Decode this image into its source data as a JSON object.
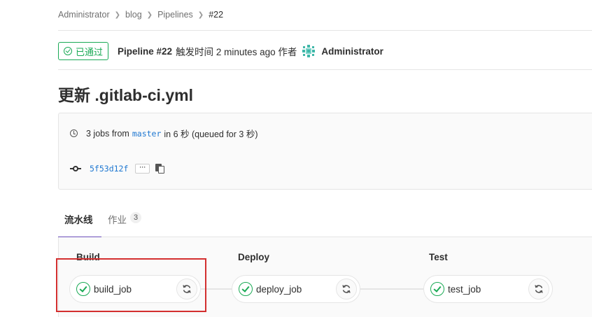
{
  "breadcrumb": [
    "Administrator",
    "blog",
    "Pipelines",
    "#22"
  ],
  "header": {
    "status_label": "已通过",
    "pipeline_title": "Pipeline #22",
    "meta_text": "触发时间 2 minutes ago 作者",
    "author": "Administrator"
  },
  "commit_title": "更新 .gitlab-ci.yml",
  "info": {
    "jobs_prefix": "3 jobs from",
    "branch": "master",
    "jobs_suffix": "in 6 秒 (queued for 3 秒)",
    "sha": "5f53d12f",
    "ellipsis": "···"
  },
  "tabs": [
    {
      "label": "流水线"
    },
    {
      "label": "作业",
      "count": "3"
    }
  ],
  "stages": [
    {
      "title": "Build",
      "job": "build_job"
    },
    {
      "title": "Deploy",
      "job": "deploy_job"
    },
    {
      "title": "Test",
      "job": "test_job"
    }
  ],
  "colors": {
    "success": "#1aaa55",
    "link": "#1f78d1",
    "tab_active": "#6b4fbb",
    "highlight": "#d32f2f"
  }
}
